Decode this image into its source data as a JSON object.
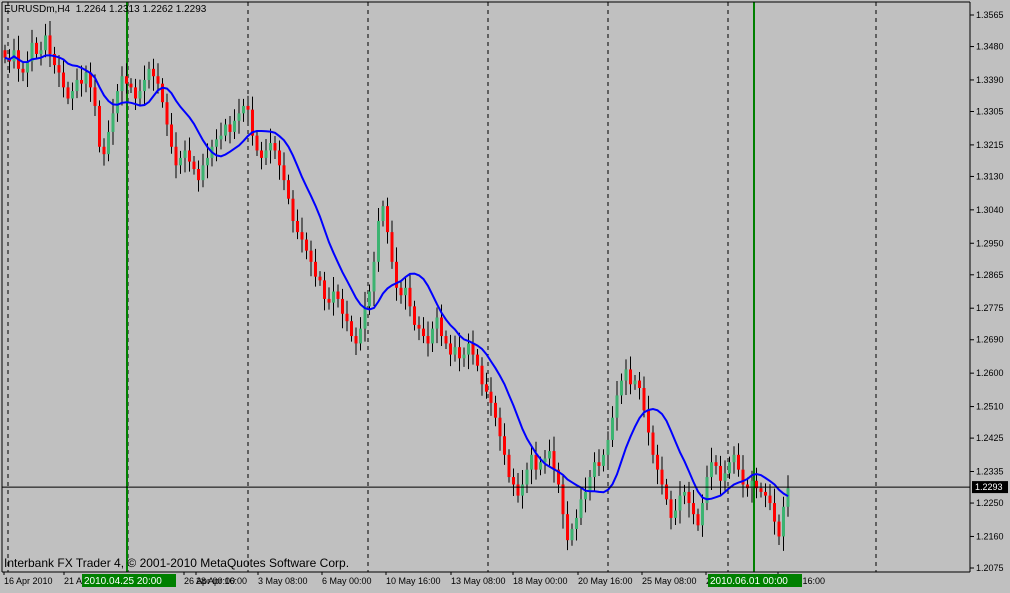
{
  "header": {
    "symbol": "EURUSDm,H4",
    "ohlc": "1.2264 1.2313 1.2262 1.2293"
  },
  "footer": {
    "copyright": "Interbank FX Trader 4, © 2001-2010 MetaQuotes Software Corp."
  },
  "colors": {
    "background": "#c0c0c0",
    "bull": "#3cb371",
    "bear": "#ff0000",
    "ma": "#0000ff",
    "vline": "#008000",
    "grid": "#000000",
    "price_label_bg": "#000000",
    "price_label_fg": "#ffffff",
    "time_label_bg": "#008000",
    "time_label_fg": "#ffffff"
  },
  "chart_data": {
    "type": "candlestick",
    "symbol": "EURUSDm",
    "timeframe": "H4",
    "ylim": [
      1.2075,
      1.3565
    ],
    "y_ticks": [
      "1.3565",
      "1.3480",
      "1.3390",
      "1.3305",
      "1.3215",
      "1.3130",
      "1.3040",
      "1.2950",
      "1.2865",
      "1.2775",
      "1.2690",
      "1.2600",
      "1.2510",
      "1.2425",
      "1.2335",
      "1.2250",
      "1.2160",
      "1.2075"
    ],
    "x_ticks": [
      "16 Apr 2010",
      "21 Apr 2010",
      "26 Apr 00:00",
      "28 Apr 16:00",
      "3 May 08:00",
      "6 May 00:00",
      "10 May 16:00",
      "13 May 08:00",
      "18 May 00:00",
      "20 May 16:00",
      "25 May 08:00",
      "28 May 00:00",
      "1 Jun 16:00"
    ],
    "current_price": "1.2293",
    "vertical_markers": [
      "2010.04.25 20:00",
      "2010.06.01 00:00"
    ],
    "series": [
      {
        "kind": "close",
        "values": [
          1.345,
          1.344,
          1.347,
          1.342,
          1.341,
          1.344,
          1.349,
          1.346,
          1.347,
          1.351,
          1.346,
          1.343,
          1.341,
          1.337,
          1.334,
          1.336,
          1.339,
          1.338,
          1.341,
          1.337,
          1.332,
          1.321,
          1.319,
          1.325,
          1.33,
          1.336,
          1.34,
          1.338,
          1.337,
          1.334,
          1.336,
          1.339,
          1.342,
          1.34,
          1.338,
          1.333,
          1.327,
          1.321,
          1.316,
          1.318,
          1.32,
          1.317,
          1.315,
          1.312,
          1.316,
          1.318,
          1.321,
          1.323,
          1.324,
          1.327,
          1.325,
          1.328,
          1.33,
          1.332,
          1.331,
          1.324,
          1.32,
          1.318,
          1.32,
          1.322,
          1.32,
          1.316,
          1.312,
          1.307,
          1.301,
          1.298,
          1.296,
          1.293,
          1.29,
          1.286,
          1.285,
          1.28,
          1.279,
          1.282,
          1.28,
          1.276,
          1.274,
          1.27,
          1.268,
          1.272,
          1.278,
          1.282,
          1.29,
          1.301,
          1.305,
          1.298,
          1.29,
          1.283,
          1.281,
          1.283,
          1.278,
          1.273,
          1.272,
          1.27,
          1.268,
          1.272,
          1.275,
          1.27,
          1.268,
          1.265,
          1.267,
          1.264,
          1.265,
          1.268,
          1.265,
          1.262,
          1.257,
          1.255,
          1.252,
          1.248,
          1.243,
          1.238,
          1.232,
          1.23,
          1.227,
          1.23,
          1.234,
          1.238,
          1.234,
          1.236,
          1.237,
          1.239,
          1.234,
          1.23,
          1.222,
          1.215,
          1.218,
          1.221,
          1.226,
          1.228,
          1.232,
          1.236,
          1.235,
          1.238,
          1.242,
          1.248,
          1.254,
          1.258,
          1.261,
          1.257,
          1.258,
          1.256,
          1.25,
          1.244,
          1.238,
          1.234,
          1.23,
          1.226,
          1.221,
          1.223,
          1.227,
          1.228,
          1.225,
          1.222,
          1.219,
          1.225,
          1.232,
          1.236,
          1.235,
          1.231,
          1.233,
          1.236,
          1.238,
          1.234,
          1.23,
          1.229,
          1.231,
          1.229,
          1.228,
          1.227,
          1.225,
          1.22,
          1.216,
          1.224,
          1.229
        ]
      }
    ]
  }
}
